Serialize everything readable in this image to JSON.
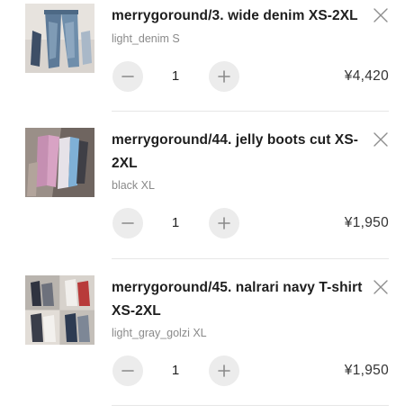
{
  "cart": {
    "items": [
      {
        "name": "merrygoround/3. wide denim XS-2XL",
        "variant": "light_denim S",
        "quantity": "1",
        "price": "¥4,420",
        "thumbnail_icon": "denim-pants-photo"
      },
      {
        "name_line1": "merrygoround/44. jelly boots cut XS-",
        "name_line2": "2XL",
        "variant": "black XL",
        "quantity": "1",
        "price": "¥1,950",
        "thumbnail_icon": "jelly-pants-photo"
      },
      {
        "name_line1": "merrygoround/45. nalrari navy T-shirt",
        "name_line2": "XS-2XL",
        "variant": "light_gray_golzi XL",
        "quantity": "1",
        "price": "¥1,950",
        "thumbnail_icon": "tshirt-collage-photo"
      }
    ],
    "icons": {
      "remove": "close-icon",
      "decrease": "minus-icon",
      "increase": "plus-icon"
    },
    "colors": {
      "button_bg": "#ececec",
      "divider": "#e6e6e6",
      "variant_text": "#8a8a8a"
    }
  }
}
